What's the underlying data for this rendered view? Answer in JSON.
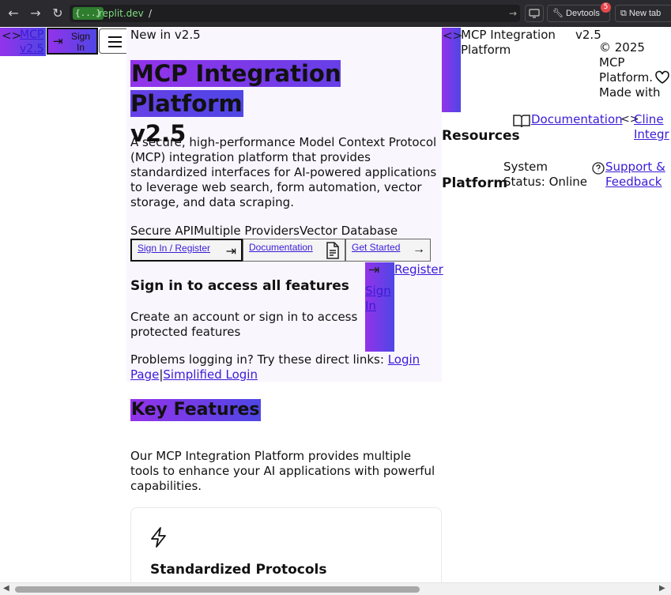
{
  "browser": {
    "back_icon": "arrow-left-icon",
    "url_badge": "{...}",
    "url_host": ".replit.dev",
    "url_path": "/",
    "devtools_label": "Devtools",
    "devtools_badge": "5",
    "newtab_label": "New tab"
  },
  "header": {
    "logo_text": "MCP v2.5",
    "signin_label": "Sign In"
  },
  "hero": {
    "badge": "New in v2.5",
    "title_highlight": "MCP Integration Platform",
    "title_rest": "v2.5",
    "description": "A secure, high-performance Model Context Protocol (MCP) integration platform that provides standardized interfaces for AI-powered applications to leverage web search, form automation, vector storage, and data scraping.",
    "features": [
      "Secure API",
      "Multiple Providers",
      "Vector Database"
    ],
    "buttons": {
      "signin": "Sign In / Register",
      "docs": "Documentation",
      "start": "Get Started"
    }
  },
  "auth": {
    "title": "Sign in to access all features",
    "description": "Create an account or sign in to access protected features",
    "help_prefix": "Problems logging in? Try these direct links: ",
    "login_page": "Login Page",
    "separator": "|",
    "simplified_login": "Simplified Login",
    "signin_link": "Sign In",
    "register_link": "Register"
  },
  "features": {
    "title": "Key Features",
    "description": "Our MCP Integration Platform provides multiple tools to enhance your AI applications with powerful capabilities.",
    "cards": [
      {
        "icon": "lightning-icon",
        "title": "Standardized Protocols"
      }
    ]
  },
  "footer": {
    "brand": "MCP Integration Platform",
    "version": "v2.5",
    "copyright": "© 2025 MCP Platform. Made with",
    "resources_heading": "Resources",
    "docs_link": "Documentation",
    "cline_link": "Cline Integr",
    "platform_heading": "Platform",
    "status": "System Status: Online",
    "support_link": "Support & Feedback"
  },
  "colors": {
    "gradient_start": "#9333ea",
    "gradient_end": "#4f46e5",
    "link": "#3b1bd6"
  }
}
